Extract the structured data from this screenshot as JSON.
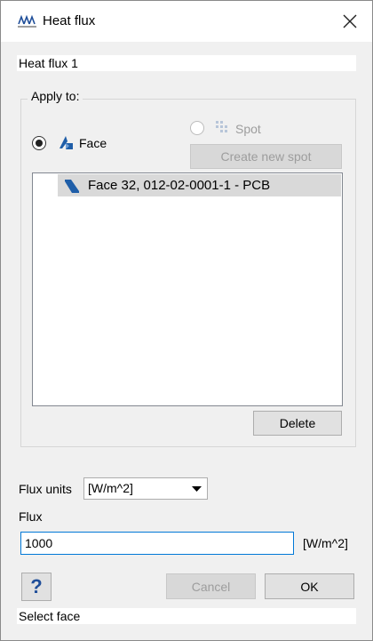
{
  "window": {
    "title": "Heat flux"
  },
  "name_field": {
    "value": "Heat flux 1"
  },
  "apply_to": {
    "group_title": "Apply to:",
    "face_label": "Face",
    "spot_label": "Spot",
    "create_new_spot_label": "Create new spot",
    "selected_face": "face",
    "items": [
      {
        "label": "Face 32, 012-02-0001-1 - PCB"
      }
    ],
    "delete_label": "Delete"
  },
  "flux_units": {
    "label": "Flux units",
    "selected": "[W/m^2]"
  },
  "flux": {
    "label": "Flux",
    "value": "1000",
    "unit": "[W/m^2]"
  },
  "buttons": {
    "help": "?",
    "cancel": "Cancel",
    "ok": "OK"
  },
  "status": {
    "text": "Select face"
  },
  "colors": {
    "accent": "#0078d7",
    "face_icon": "#1f5ea8",
    "selection": "#d9d9d9"
  }
}
